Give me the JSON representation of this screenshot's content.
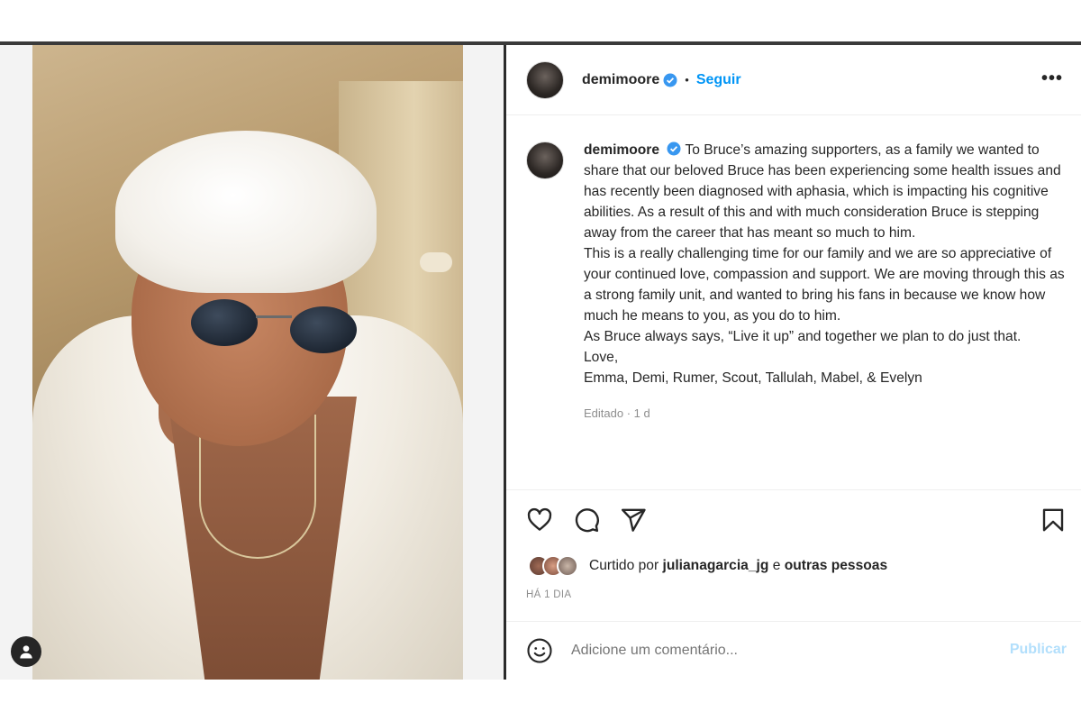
{
  "post": {
    "username": "demimoore",
    "dot": "•",
    "follow_label": "Seguir",
    "more_label": "•••"
  },
  "caption": {
    "username": "demimoore",
    "paragraphs": [
      "To Bruce’s amazing supporters, as a family we wanted to share that our beloved Bruce has been experiencing some health issues and has recently been diagnosed with aphasia, which is impacting his cognitive abilities. As a result of this and with much consideration Bruce is stepping away from the career that has meant so much to him.",
      "This is a really challenging time for our family and we are so appreciative of your continued love, compassion and support. We are moving through this as a strong family unit, and wanted to bring his fans in because we know how much he means to you, as you do to him.",
      "As Bruce always says, “Live it up” and together we plan to do just that.",
      "Love,",
      "Emma, Demi, Rumer, Scout, Tallulah, Mabel, & Evelyn"
    ],
    "edited": "Editado · 1 d"
  },
  "likes": {
    "prefix": "Curtido por",
    "user": "julianagarcia_jg",
    "conjunction": "e",
    "others": "outras pessoas"
  },
  "time_label": "HÁ 1 DIA",
  "comment": {
    "placeholder": "Adicione um comentário...",
    "publish_label": "Publicar"
  },
  "icons": {
    "verified": "verified-badge-icon",
    "like": "heart-icon",
    "comment": "comment-bubble-icon",
    "share": "paper-plane-icon",
    "save": "bookmark-icon",
    "emoji": "smiley-icon",
    "user": "user-silhouette-icon"
  },
  "colors": {
    "link_blue": "#0095f6",
    "publish_disabled": "#b2dffc",
    "muted_text": "#8e8e8e"
  }
}
